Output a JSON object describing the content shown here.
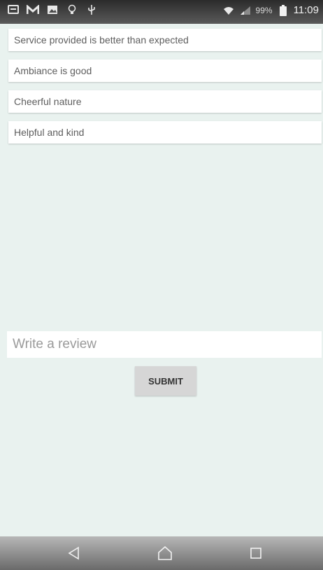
{
  "status_bar": {
    "battery_text": "99%",
    "time": "11:09",
    "icons_left": [
      "message-icon",
      "gmail-icon",
      "image-icon",
      "lightbulb-icon",
      "usb-icon"
    ],
    "icons_right": [
      "wifi-icon",
      "signal-icon",
      "battery-icon"
    ]
  },
  "checklist": {
    "items": [
      {
        "label": "Service provided is better than expected"
      },
      {
        "label": "Ambiance is good"
      },
      {
        "label": "Cheerful nature"
      },
      {
        "label": "Helpful and kind"
      }
    ]
  },
  "review": {
    "placeholder": "Write a review",
    "value": ""
  },
  "actions": {
    "submit_label": "SUBMIT"
  },
  "nav_bar": {
    "icons": [
      "back-icon",
      "home-icon",
      "recents-icon"
    ]
  },
  "colors": {
    "background": "#e9f2ef",
    "card": "#ffffff",
    "button": "#d6d6d6"
  }
}
